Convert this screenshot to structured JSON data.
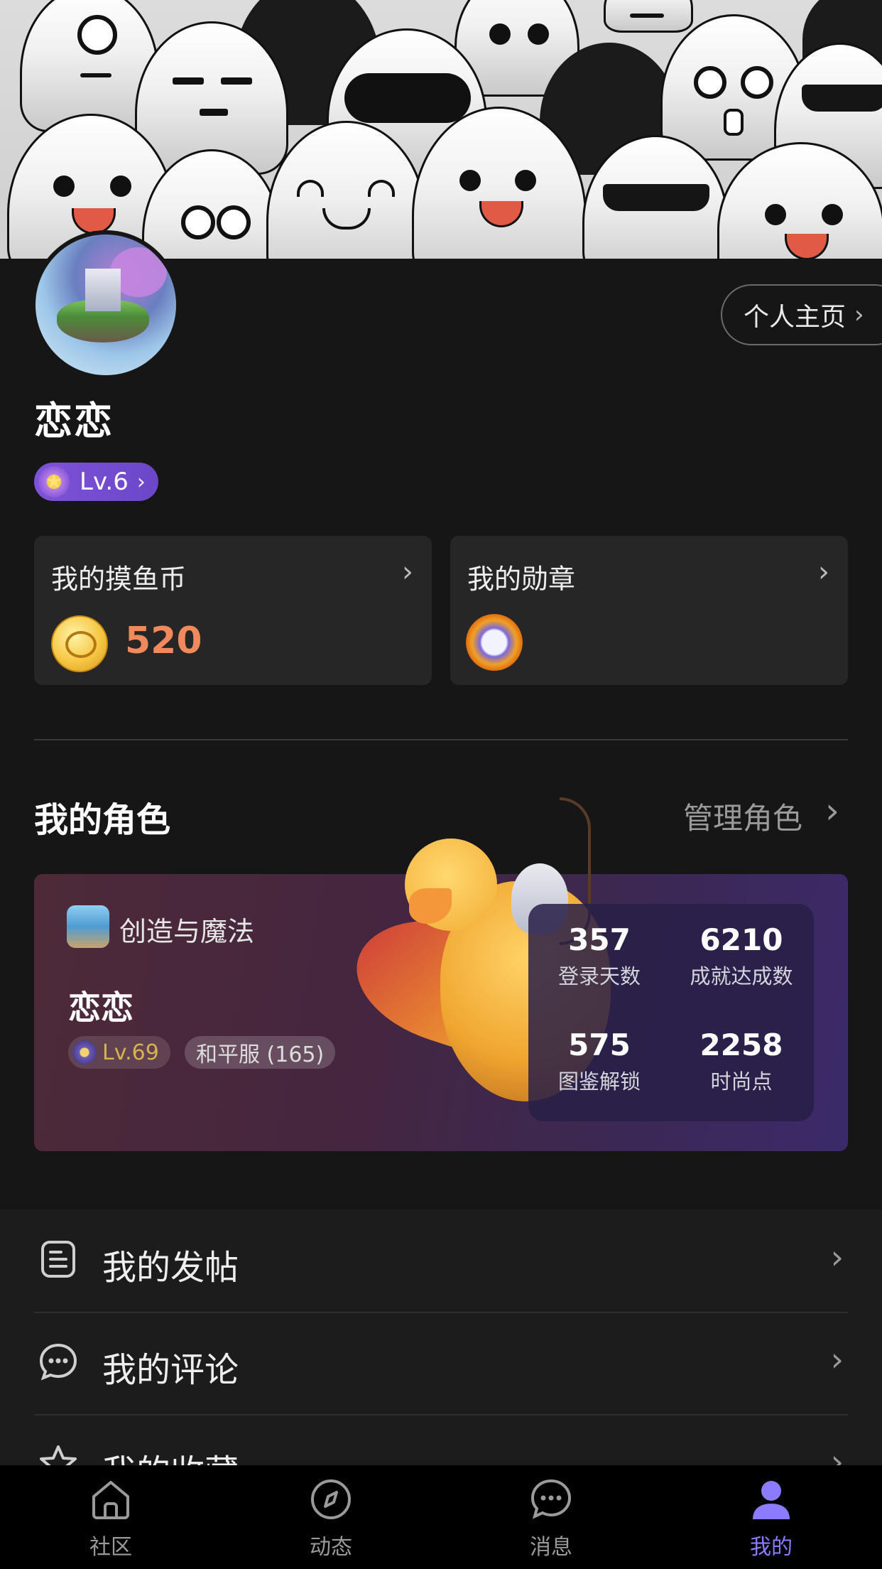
{
  "profile": {
    "username": "恋恋",
    "level_label": "Lv.6",
    "homepage_button": "个人主页"
  },
  "cards": {
    "coins": {
      "title": "我的摸鱼币",
      "value": "520"
    },
    "medals": {
      "title": "我的勋章"
    }
  },
  "roles": {
    "title": "我的角色",
    "manage_label": "管理角色",
    "game_name": "创造与魔法",
    "role_name": "恋恋",
    "role_level": "Lv.69",
    "server": "和平服 (165)",
    "stats": [
      {
        "value": "357",
        "label": "登录天数"
      },
      {
        "value": "6210",
        "label": "成就达成数"
      },
      {
        "value": "575",
        "label": "图鉴解锁"
      },
      {
        "value": "2258",
        "label": "时尚点"
      }
    ]
  },
  "menu": [
    {
      "label": "我的发帖",
      "icon": "document-icon"
    },
    {
      "label": "我的评论",
      "icon": "comment-icon"
    },
    {
      "label": "我的收藏",
      "icon": "star-icon"
    }
  ],
  "tabs": [
    {
      "label": "社区",
      "icon": "home-icon",
      "active": false
    },
    {
      "label": "动态",
      "icon": "compass-icon",
      "active": false
    },
    {
      "label": "消息",
      "icon": "chat-icon",
      "active": false
    },
    {
      "label": "我的",
      "icon": "user-icon",
      "active": true
    }
  ],
  "colors": {
    "background": "#161616",
    "accent": "#8a7bff",
    "coin_value": "#f08a5d",
    "level_badge": "#7e52d8"
  }
}
